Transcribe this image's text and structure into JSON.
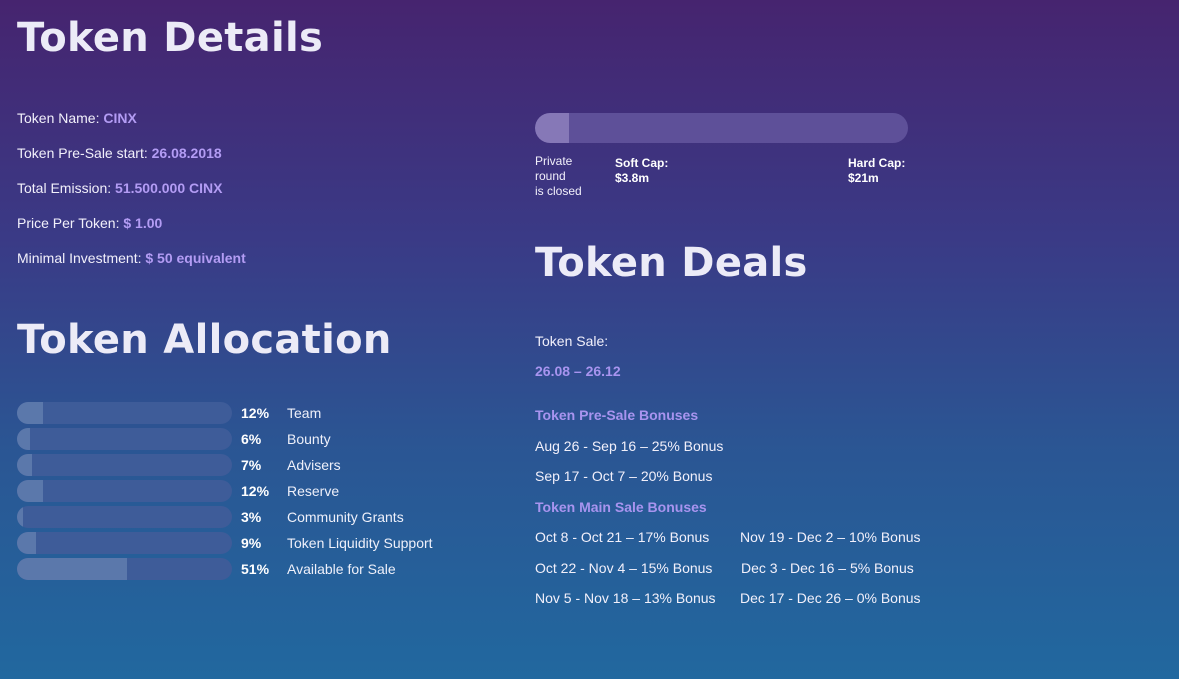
{
  "token_details": {
    "title": "Token Details",
    "rows": [
      {
        "label": "Token Name:",
        "value": "CINX"
      },
      {
        "label": "Token Pre-Sale start:",
        "value": "26.08.2018"
      },
      {
        "label": "Total Emission:",
        "value": "51.500.000 CINX"
      },
      {
        "label": "Price Per Token:",
        "value": "$ 1.00"
      },
      {
        "label": "Minimal Investment:",
        "value": "$ 50 equivalent"
      }
    ]
  },
  "progress": {
    "fill_fraction": 0.09,
    "private_round": [
      "Private",
      "round",
      "is closed"
    ],
    "soft_cap_label": "Soft Cap:",
    "soft_cap_value": "$3.8m",
    "hard_cap_label": "Hard Cap:",
    "hard_cap_value": "$21m"
  },
  "allocation": {
    "title": "Token Allocation",
    "items": [
      {
        "percent": "12%",
        "value": 12,
        "name": "Team"
      },
      {
        "percent": "6%",
        "value": 6,
        "name": "Bounty"
      },
      {
        "percent": "7%",
        "value": 7,
        "name": "Advisers"
      },
      {
        "percent": "12%",
        "value": 12,
        "name": "Reserve"
      },
      {
        "percent": "3%",
        "value": 3,
        "name": "Community Grants"
      },
      {
        "percent": "9%",
        "value": 9,
        "name": "Token Liquidity Support"
      },
      {
        "percent": "51%",
        "value": 51,
        "name": "Available for Sale"
      }
    ]
  },
  "deals": {
    "title": "Token Deals",
    "sale_label": "Token Sale:",
    "sale_dates": "26.08 – 26.12",
    "presale_title": "Token Pre-Sale Bonuses",
    "presale": [
      "Aug 26 - Sep 16 – 25% Bonus",
      "Sep 17 - Oct 7 – 20% Bonus"
    ],
    "main_title": "Token Main Sale Bonuses",
    "main_left": [
      "Oct 8 - Oct 21 – 17% Bonus",
      "Oct 22 - Nov 4 – 15% Bonus",
      "Nov 5 - Nov 18 – 13% Bonus"
    ],
    "main_right": [
      "Nov 19 - Dec 2 – 10% Bonus",
      "Dec 3 - Dec 16 – 5% Bonus",
      "Dec 17 - Dec 26 – 0% Bonus"
    ]
  }
}
